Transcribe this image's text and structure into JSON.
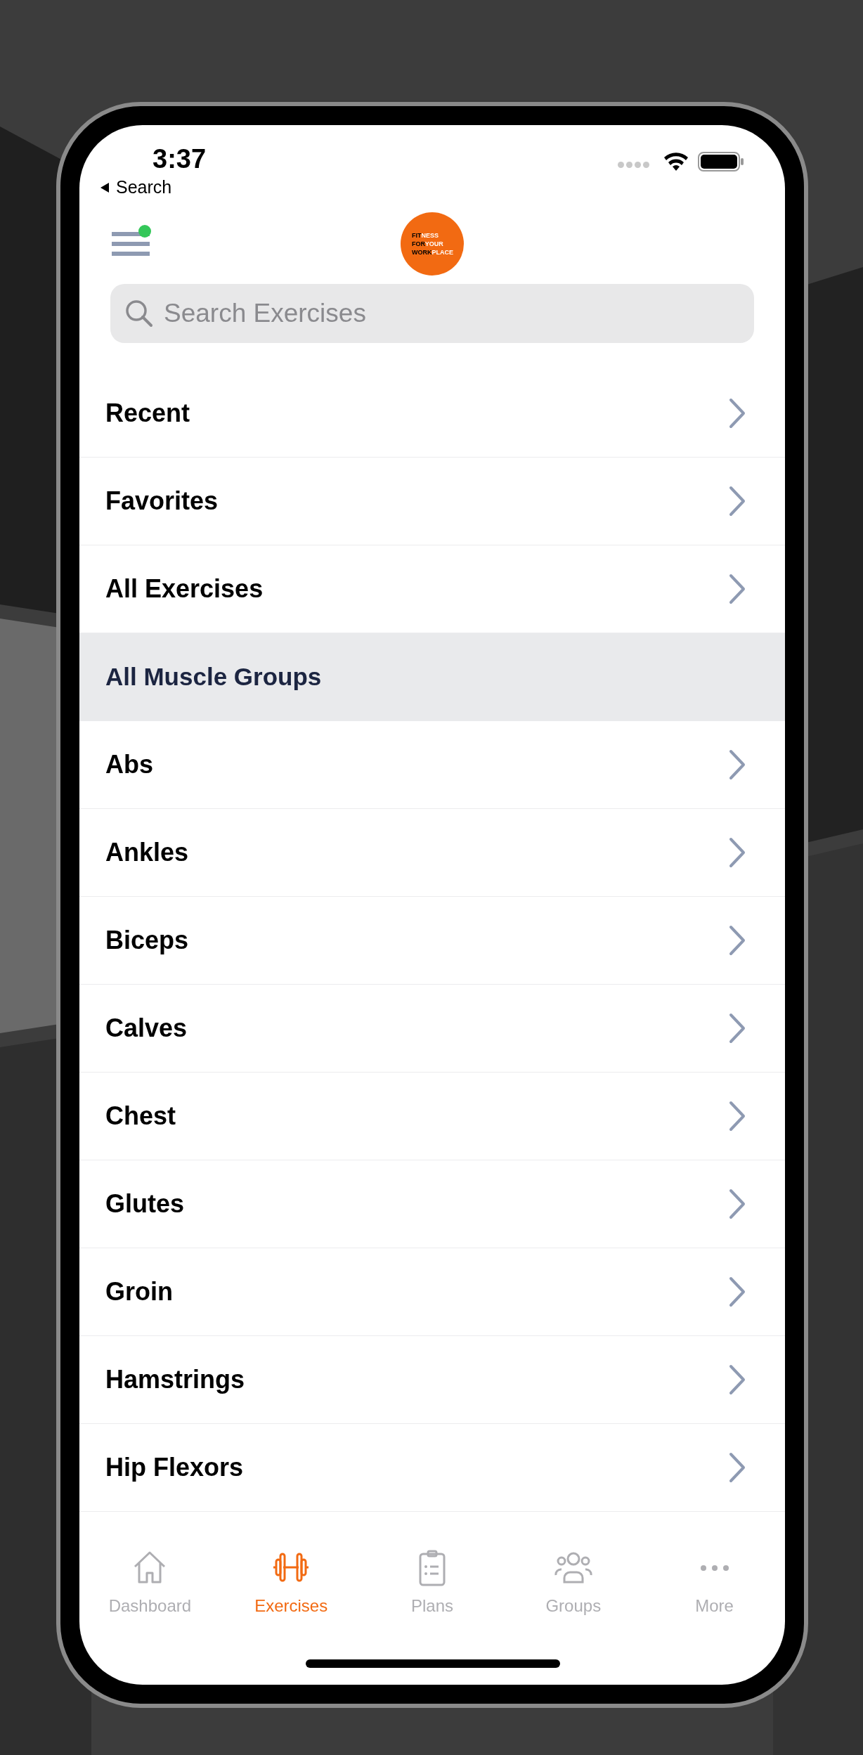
{
  "status_bar": {
    "time": "3:37",
    "back_label": "Search"
  },
  "header": {
    "menu": {
      "badge": true
    },
    "logo": [
      {
        "dark": "FIT",
        "light": "NESS"
      },
      {
        "dark": "FOR",
        "light": "YOUR"
      },
      {
        "dark": "WORK",
        "light": "PLACE"
      }
    ]
  },
  "search": {
    "placeholder": "Search Exercises"
  },
  "list": [
    {
      "kind": "row",
      "label": "Recent"
    },
    {
      "kind": "row",
      "label": "Favorites"
    },
    {
      "kind": "row",
      "label": "All Exercises"
    },
    {
      "kind": "section",
      "label": "All Muscle Groups"
    },
    {
      "kind": "row",
      "label": "Abs"
    },
    {
      "kind": "row",
      "label": "Ankles"
    },
    {
      "kind": "row",
      "label": "Biceps"
    },
    {
      "kind": "row",
      "label": "Calves"
    },
    {
      "kind": "row",
      "label": "Chest"
    },
    {
      "kind": "row",
      "label": "Glutes"
    },
    {
      "kind": "row",
      "label": "Groin"
    },
    {
      "kind": "row",
      "label": "Hamstrings"
    },
    {
      "kind": "row",
      "label": "Hip Flexors"
    }
  ],
  "tab_bar": [
    {
      "label": "Dashboard",
      "selected": false
    },
    {
      "label": "Exercises",
      "selected": true
    },
    {
      "label": "Plans",
      "selected": false
    },
    {
      "label": "Groups",
      "selected": false
    },
    {
      "label": "More",
      "selected": false
    }
  ]
}
